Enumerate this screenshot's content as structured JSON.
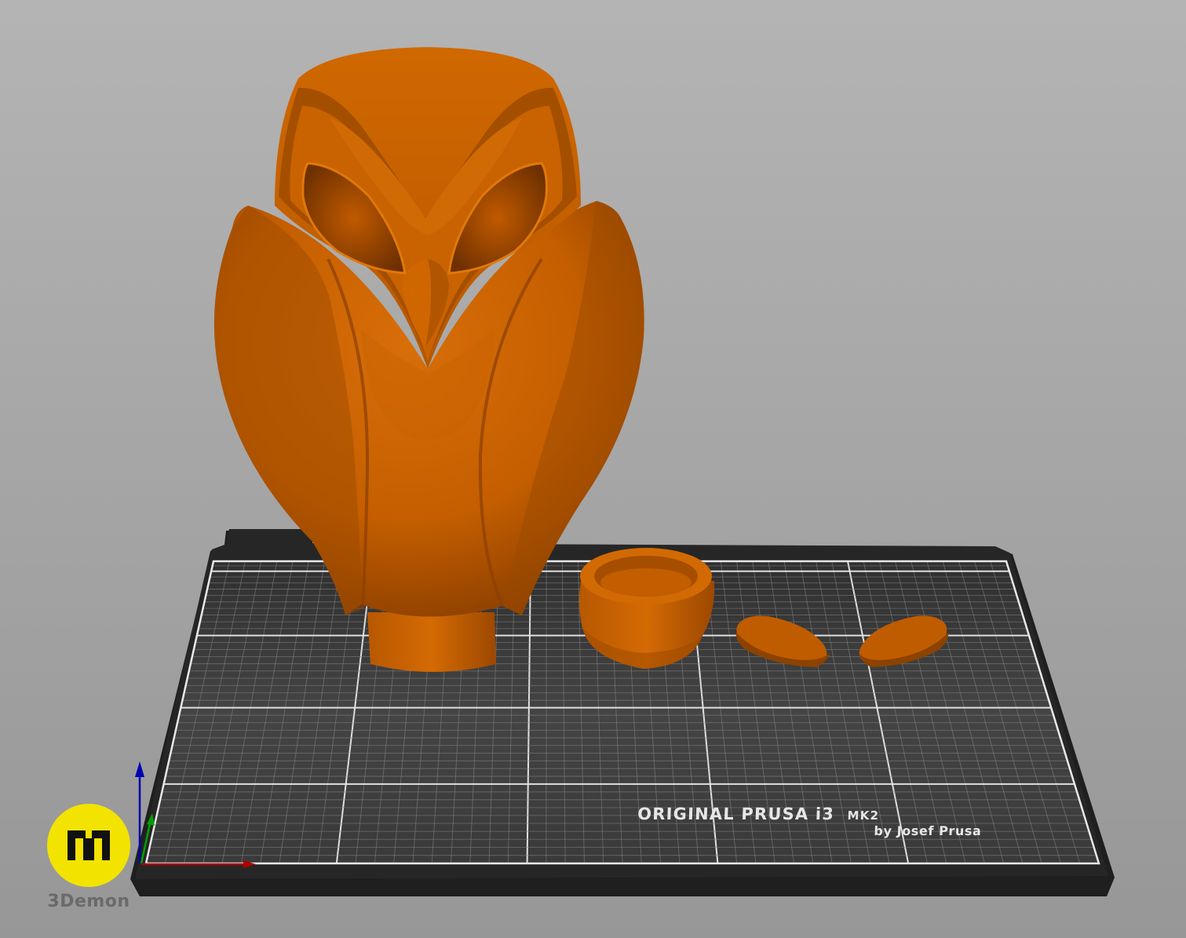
{
  "scene": {
    "background_top": "#b4b4b4",
    "background_bottom": "#979797",
    "model_color": "#c86100",
    "bed_color": "#3a3a3a",
    "bed_frame_color": "#242424",
    "grid_color": "#8a8a8a",
    "grid_major_color": "#e8e8e8"
  },
  "bed": {
    "title": "ORIGINAL PRUSA i3",
    "model_suffix": "MK2",
    "subtitle": "by Josef Prusa"
  },
  "objects": [
    {
      "name": "owl-body"
    },
    {
      "name": "owl-base-cup"
    },
    {
      "name": "owl-wing-left"
    },
    {
      "name": "owl-wing-right"
    }
  ],
  "axes": {
    "x_color": "#b00000",
    "y_color": "#00a000",
    "z_color": "#0000b0"
  },
  "watermark": {
    "label": "3Demon",
    "badge_color": "#f2e300"
  }
}
